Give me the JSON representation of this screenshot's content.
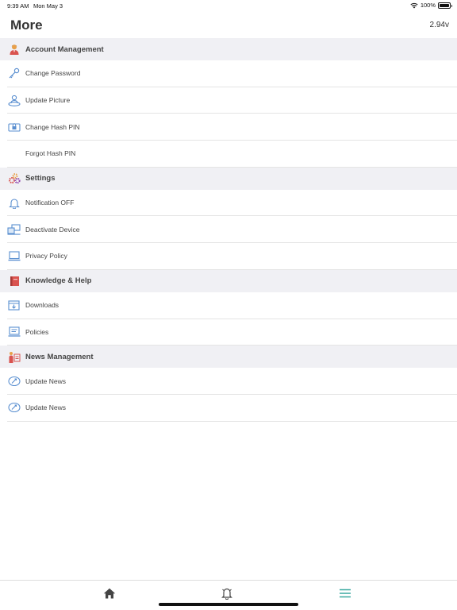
{
  "status": {
    "time": "9:39 AM",
    "date": "Mon May 3",
    "battery": "100%"
  },
  "header": {
    "title": "More",
    "version": "2.94v"
  },
  "sections": [
    {
      "label": "Account Management",
      "icon": "user-icon",
      "items": [
        {
          "label": "Change Password",
          "icon": "key-icon"
        },
        {
          "label": "Update Picture",
          "icon": "picture-upload-icon"
        },
        {
          "label": "Change Hash PIN",
          "icon": "lock-screen-icon"
        },
        {
          "label": "Forgot Hash PIN",
          "icon": ""
        }
      ]
    },
    {
      "label": "Settings",
      "icon": "gears-icon",
      "items": [
        {
          "label": "Notification OFF",
          "icon": "bell-icon"
        },
        {
          "label": "Deactivate Device",
          "icon": "devices-icon"
        },
        {
          "label": "Privacy Policy",
          "icon": "laptop-icon"
        }
      ]
    },
    {
      "label": "Knowledge & Help",
      "icon": "book-icon",
      "items": [
        {
          "label": "Downloads",
          "icon": "download-box-icon"
        },
        {
          "label": "Policies",
          "icon": "document-icon"
        }
      ]
    },
    {
      "label": "News Management",
      "icon": "presenter-icon",
      "items": [
        {
          "label": "Update News",
          "icon": "refresh-icon"
        },
        {
          "label": "Update News",
          "icon": "refresh-icon"
        }
      ]
    }
  ],
  "tabs": [
    {
      "name": "home",
      "icon": "home-icon"
    },
    {
      "name": "notifications",
      "icon": "bell-icon"
    },
    {
      "name": "more",
      "icon": "menu-icon",
      "active": true
    }
  ],
  "colors": {
    "accent": "#3aa9a0",
    "section_bg": "#f0f0f4",
    "icon_blue": "#5a8fd0"
  }
}
